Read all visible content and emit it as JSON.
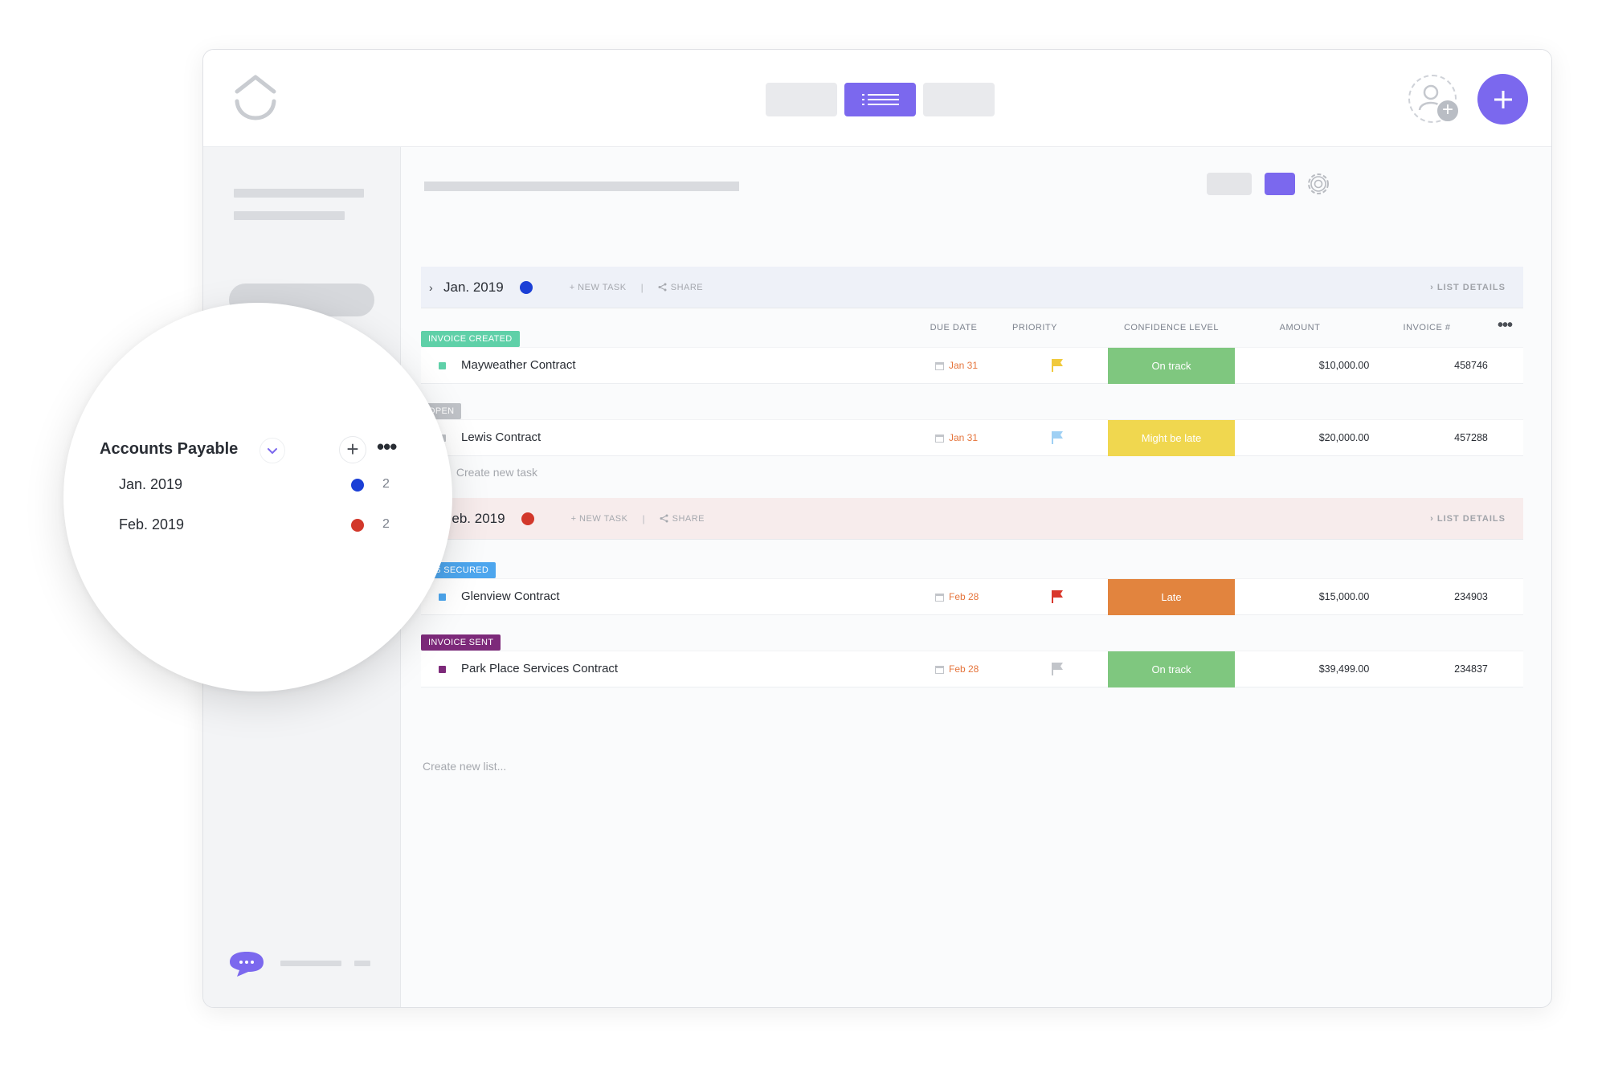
{
  "colors": {
    "accent": "#7b68ee",
    "jan_dot": "#1b3fd6",
    "feb_dot": "#d2382b",
    "status_invoice_created": "#5fd0a8",
    "status_open": "#bfc2c7",
    "status_funds_secured": "#4da6ee",
    "status_invoice_sent": "#7d2a7a",
    "conf_on_track": "#7fc77f",
    "conf_might_be_late": "#f0d74f",
    "conf_late": "#e2843e",
    "flag_yellow": "#f0c93c",
    "flag_lightblue": "#9fd0f4",
    "flag_red": "#d9372b",
    "flag_grey": "#c2c5ca"
  },
  "columns": {
    "due_date": "DUE DATE",
    "priority": "PRIORITY",
    "confidence": "CONFIDENCE LEVEL",
    "amount": "AMOUNT",
    "invoice": "INVOICE #"
  },
  "lists": {
    "jan": {
      "title": "Jan. 2019",
      "new_task": "+ NEW TASK",
      "separator": "|",
      "share": "SHARE",
      "details": "LIST DETAILS"
    },
    "feb": {
      "title": "Feb. 2019",
      "new_task": "+ NEW TASK",
      "separator": "|",
      "share": "SHARE",
      "details": "LIST DETAILS"
    }
  },
  "statuses": {
    "invoice_created": "INVOICE CREATED",
    "open": "OPEN",
    "funds_secured": "DS SECURED",
    "invoice_sent": "INVOICE SENT"
  },
  "tasks": [
    {
      "name": "Mayweather Contract",
      "due": "Jan 31",
      "priority_icon": "flag-yellow-icon",
      "confidence": "On track",
      "amount": "$10,000.00",
      "invoice": "458746"
    },
    {
      "name": "Lewis Contract",
      "due": "Jan 31",
      "priority_icon": "flag-lightblue-icon",
      "confidence": "Might be late",
      "amount": "$20,000.00",
      "invoice": "457288"
    },
    {
      "name": "Glenview Contract",
      "due": "Feb 28",
      "priority_icon": "flag-red-icon",
      "confidence": "Late",
      "amount": "$15,000.00",
      "invoice": "234903"
    },
    {
      "name": "Park Place Services Contract",
      "due": "Feb 28",
      "priority_icon": "flag-grey-icon",
      "confidence": "On track",
      "amount": "$39,499.00",
      "invoice": "234837"
    }
  ],
  "create_new_task": "Create new task",
  "create_new_list": "Create new list...",
  "sidebar_zoom": {
    "title": "Accounts Payable",
    "items": [
      {
        "label": "Jan. 2019",
        "count": "2"
      },
      {
        "label": "Feb. 2019",
        "count": "2"
      }
    ]
  }
}
